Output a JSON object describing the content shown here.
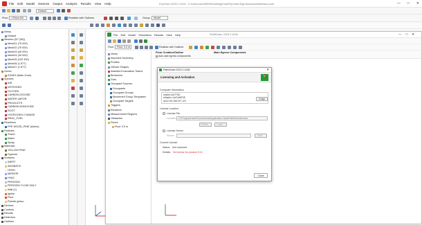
{
  "app": {
    "title": "PyroSim 2023.2.1015 - C:\\Users\\rud\\NEW\\Drafting\\Coal\\PyroneerSgk Advanced\\flabrass.psm",
    "menu": [
      "File",
      "Edit",
      "Model",
      "Devices",
      "Output",
      "Analysis",
      "Results",
      "View",
      "Help"
    ],
    "window_controls": [
      "—",
      "□",
      "✕"
    ]
  },
  "toolbar": {
    "floor_label": "Floor:",
    "floor_value": "<Show All>",
    "render_mode": "Realistic with Outlines",
    "group_label": "Group:",
    "group_value": "Model",
    "default_label": "Default"
  },
  "tree": {
    "items": [
      {
        "label": "Views",
        "color": "#6f8bb8"
      },
      {
        "label": "Default",
        "color": "#6f8bb8"
      },
      {
        "label": "Meshes (5/7 (55))",
        "color": "#7a7a7a"
      },
      {
        "label": "Mesh01 (75 000)",
        "color": "#7f9ad0"
      },
      {
        "label": "Mesh02 (75 000)",
        "color": "#7f9ad0"
      },
      {
        "label": "Mesh03 (40 000)",
        "color": "#7f9ad0"
      },
      {
        "label": "Mesh04 (40 000)",
        "color": "#7f9ad0"
      },
      {
        "label": "Mesh05 (102 400)",
        "color": "#7f9ad0"
      },
      {
        "label": "Mesh06 (1 877)",
        "color": "#7f9ad0"
      },
      {
        "label": "Mesh07 (1 877)",
        "color": "#7f9ad0"
      },
      {
        "label": "Zones",
        "color": "#b48a3a"
      },
      {
        "label": "ZONE4 (Main Zone)",
        "color": "#b48a3a"
      },
      {
        "label": "Species",
        "color": "#c14040"
      },
      {
        "label": "AIR",
        "color": "#c14040"
      },
      {
        "label": "NITROGEN",
        "color": "#c14040"
      },
      {
        "label": "OXYGEN",
        "color": "#c14040"
      },
      {
        "label": "CARBON DIOXIDE",
        "color": "#c14040"
      },
      {
        "label": "WATER VAPOR",
        "color": "#c14040"
      },
      {
        "label": "PRODUCTS",
        "color": "#c14040"
      },
      {
        "label": "CARBON MONOXIDE",
        "color": "#c14040"
      },
      {
        "label": "SOOT",
        "color": "#c14040"
      },
      {
        "label": "HYDROGEN CYANIDE",
        "color": "#c14040"
      },
      {
        "label": "REAC_FUEL",
        "color": "#c14040"
      },
      {
        "label": "Reactions",
        "color": "#2f6fb0"
      },
      {
        "label": "FPE WOOD_PINE (Active)",
        "color": "#2f6fb0"
      },
      {
        "label": "Particles",
        "color": "#3a9a4a"
      },
      {
        "label": "Tracer",
        "color": "#3a9a4a"
      },
      {
        "label": "Water",
        "color": "#3a9a4a"
      },
      {
        "label": "Spray",
        "color": "#3a9a4a"
      },
      {
        "label": "Materials",
        "color": "#8c6b3a"
      },
      {
        "label": "YELLOW PINE",
        "color": "#8c6b3a"
      },
      {
        "label": "Gypsum",
        "color": "#8c6b3a"
      },
      {
        "label": "Surfaces",
        "color": "#555"
      },
      {
        "label": "INERT",
        "color": "#d3d3d3"
      },
      {
        "label": "ADIABATIC",
        "color": "#e8c35a"
      },
      {
        "label": "OPEN",
        "color": "#f0f0ff"
      },
      {
        "label": "MIRROR",
        "color": "#9aa0ff"
      },
      {
        "label": "HVAC",
        "color": "#6b8fd8"
      },
      {
        "label": "PERIODIC",
        "color": "#c0c0c0"
      },
      {
        "label": "PERIODIC FLOW ONLY",
        "color": "#c0c0c0"
      },
      {
        "label": "Wall (1)",
        "color": "#e9d39a"
      },
      {
        "label": "Ignitor",
        "color": "#e86d2b"
      },
      {
        "label": "Floor",
        "color": "#e8443a"
      },
      {
        "label": "Parede gesso",
        "color": "#e7c66b"
      },
      {
        "label": "Devices",
        "color": "#555"
      },
      {
        "label": "Controls",
        "color": "#555"
      },
      {
        "label": "Results",
        "color": "#555"
      },
      {
        "label": "Detectors",
        "color": "#555"
      },
      {
        "label": "Outlines",
        "color": "#555"
      }
    ]
  },
  "inner_window": {
    "menu": [
      "File",
      "Edit",
      "Model",
      "Simulation",
      "Results",
      "View",
      "Help"
    ],
    "title": "PathFinder 2023.2.1006",
    "floor_label": "Floor:",
    "floor_value": "Floor 0.0 m",
    "render_mode": "Realistic with Outlines",
    "panel_floor_creation": "Floor Creation/Outline",
    "panel_auto_egress": "Auto add egress components",
    "panel_egress_components": "Main Egress Components",
    "tree": [
      "Views",
      "Imported Geometry",
      "Profiles",
      "Vehicle Shapes",
      "Assisted Evacuation Teams",
      "Behaviors",
      "Goto",
      "Occupant Sources",
      "Occupants",
      "Occupant Groups",
      "Movement Group Templates",
      "Occupant Targets",
      "Triggers",
      "Elevators",
      "Measurement Regions",
      "Obstacles",
      "Floors",
      "Floor 0.0 m"
    ],
    "coords": "(0.00, 0.00, 0.00) m"
  },
  "dialog": {
    "title": "PathWorks 2023.2.1006",
    "heading": "Licensing and Activation",
    "computer_info_label": "Computer Information",
    "computer_info_lines": [
      "hostid=1a47751f",
      "ethaddr=1a47a38F0E",
      "ipv4=192.168.247.123"
    ],
    "copy_button": "Copy",
    "license_location_label": "License Location",
    "license_file_label": "License File",
    "location_label": "Location:",
    "location_value": "C:\\ProgramData\\Thunderhead\\Application Data\\PathWorks\\license",
    "delete_button": "Delete...",
    "load_button": "Load...",
    "license_server_label": "License Server",
    "server_label": "Server:",
    "edit_button": "Edit...",
    "current_license_label": "Current License",
    "status_label": "Status:",
    "status_value": "Not Licensed",
    "details_label": "Details:",
    "details_value": "No license for product 5.11",
    "close_button": "Close",
    "accent_color": "#1f9a3a"
  }
}
